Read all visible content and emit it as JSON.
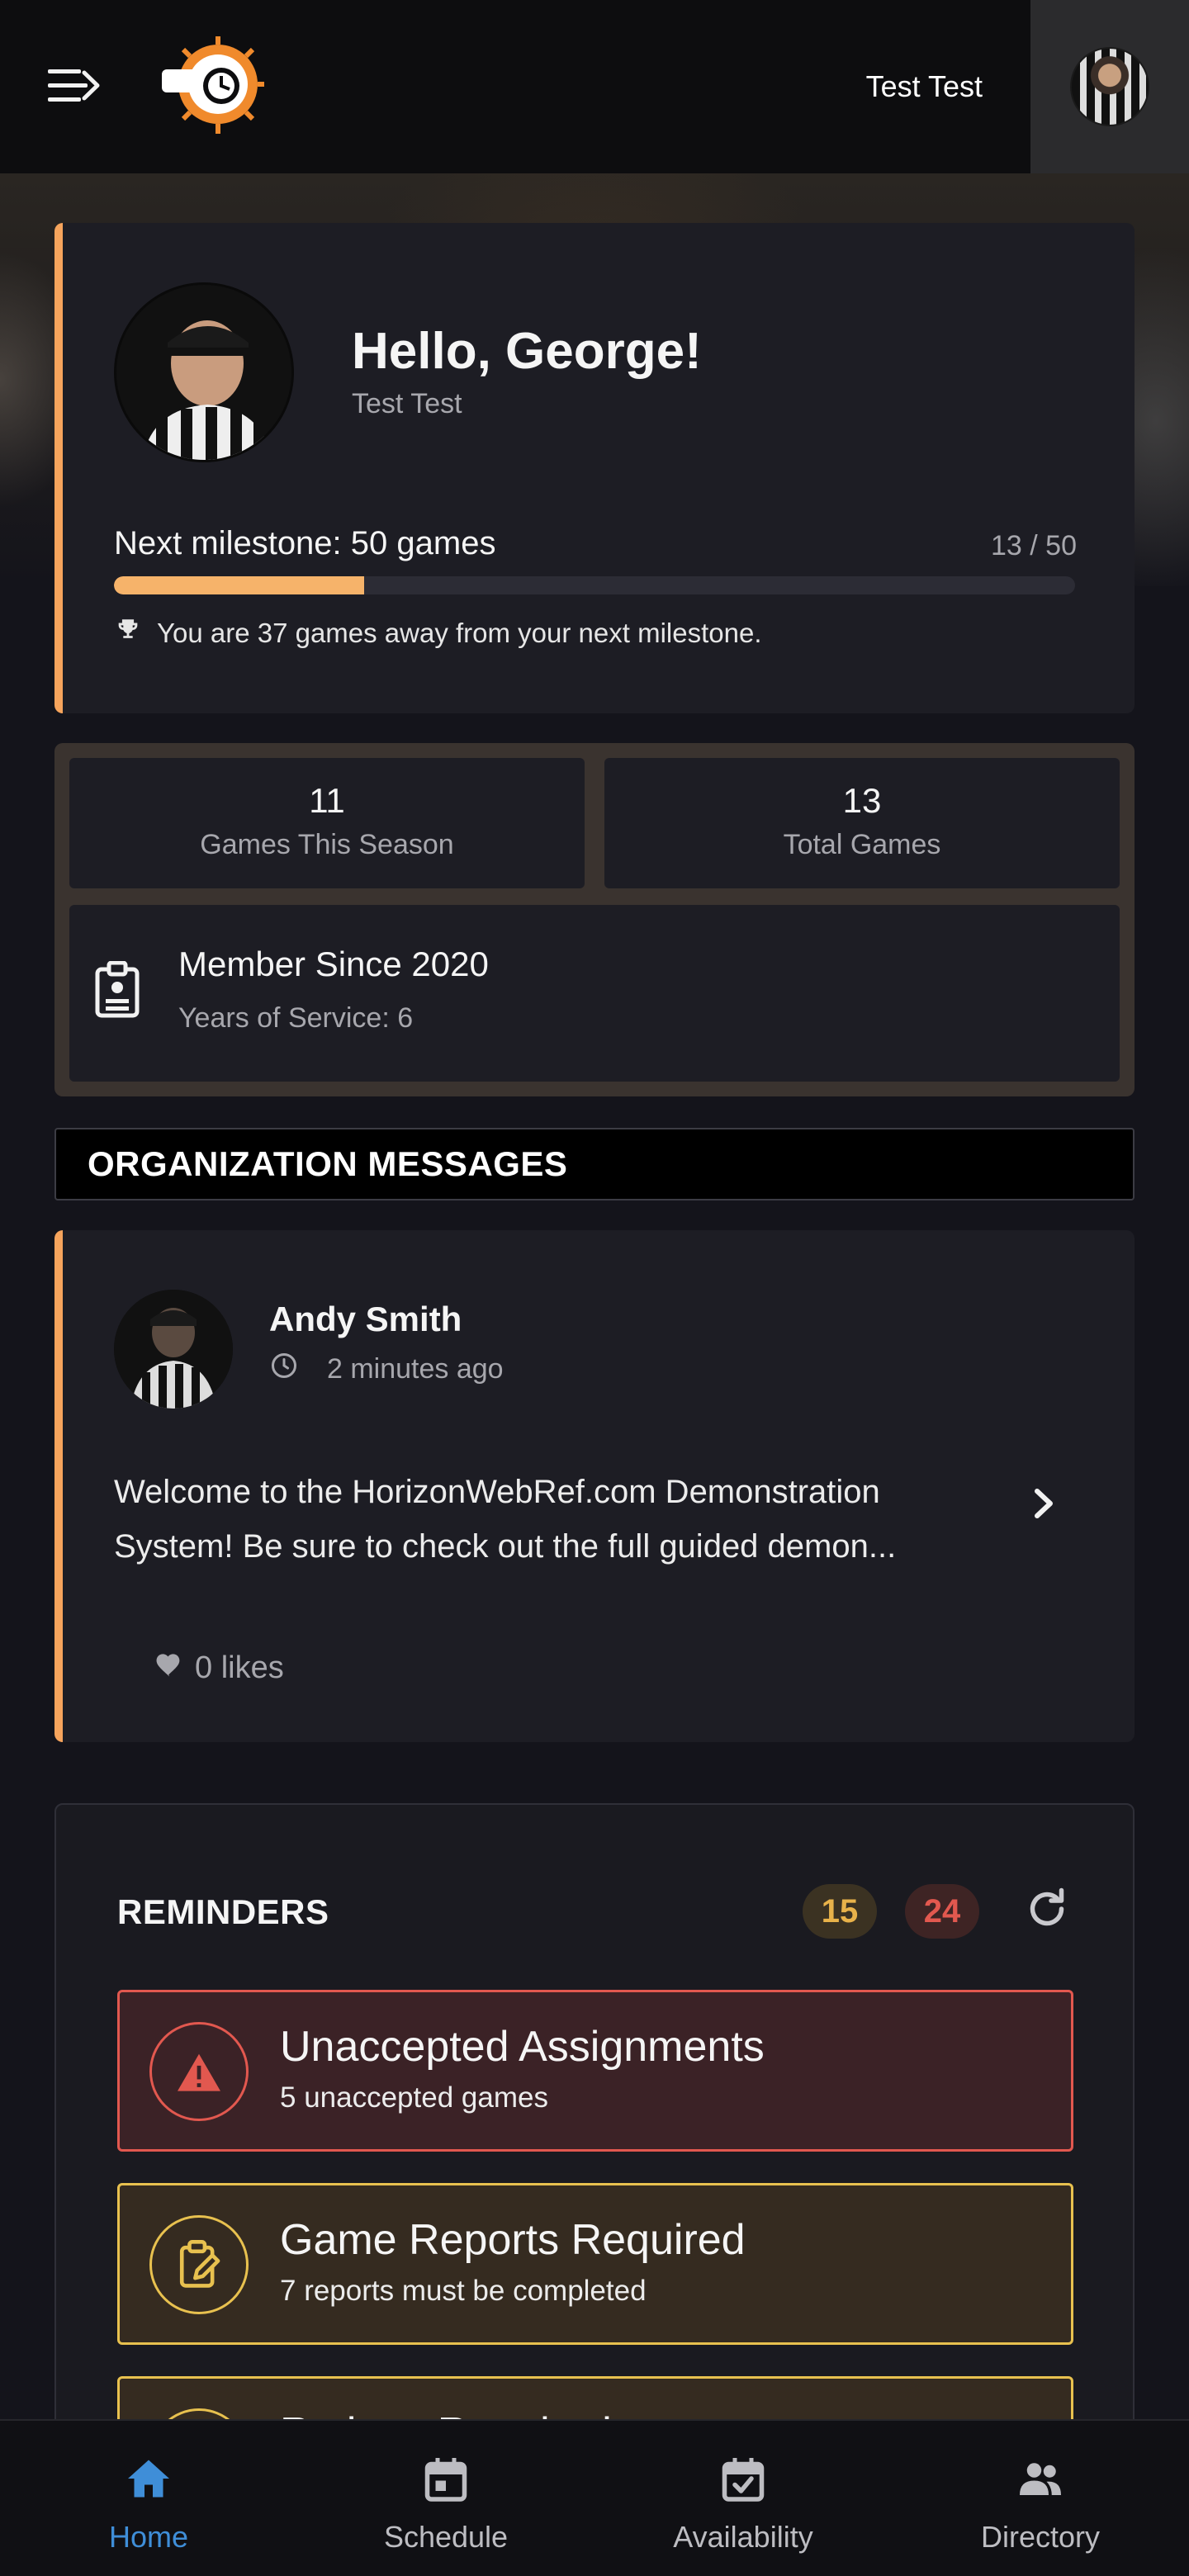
{
  "header": {
    "user_name": "Test Test",
    "icons": [
      "menu-icon",
      "whistle-logo",
      "user-avatar"
    ]
  },
  "profile": {
    "greeting": "Hello, George!",
    "subtitle": "Test Test",
    "milestone_label": "Next milestone: 50 games",
    "milestone_count": "13 / 50",
    "milestone_progress": 0.26,
    "milestone_note": "You are 37 games away from your next milestone."
  },
  "stats": {
    "games_this_season": "11",
    "games_this_season_label": "Games This Season",
    "total_games": "13",
    "total_games_label": "Total Games",
    "member_since": "Member Since 2020",
    "years_of_service": "Years of Service: 6"
  },
  "messages": {
    "section_title": "ORGANIZATION MESSAGES",
    "items": [
      {
        "author": "Andy Smith",
        "time": "2 minutes ago",
        "body": "Welcome to the HorizonWebRef.com Demonstration System! Be sure to check out the full guided demon...",
        "likes": "0 likes"
      }
    ]
  },
  "reminders": {
    "title": "REMINDERS",
    "count_warning": "15",
    "count_alert": "24",
    "items": [
      {
        "title": "Unaccepted Assignments",
        "subtitle": "5 unaccepted games",
        "level": "alert"
      },
      {
        "title": "Game Reports Required",
        "subtitle": "7 reports must be completed",
        "level": "warning"
      },
      {
        "title": "Ratings Required",
        "subtitle": "",
        "level": "warning"
      }
    ]
  },
  "nav": {
    "items": [
      {
        "label": "Home",
        "icon": "home-icon",
        "active": true
      },
      {
        "label": "Schedule",
        "icon": "calendar-icon",
        "active": false
      },
      {
        "label": "Availability",
        "icon": "calendar-check-icon",
        "active": false
      },
      {
        "label": "Directory",
        "icon": "people-icon",
        "active": false
      }
    ]
  },
  "colors": {
    "accent": "#f6a45c",
    "alert": "#e2584f",
    "warning": "#e8c14f",
    "nav_active": "#3f8ed8"
  }
}
